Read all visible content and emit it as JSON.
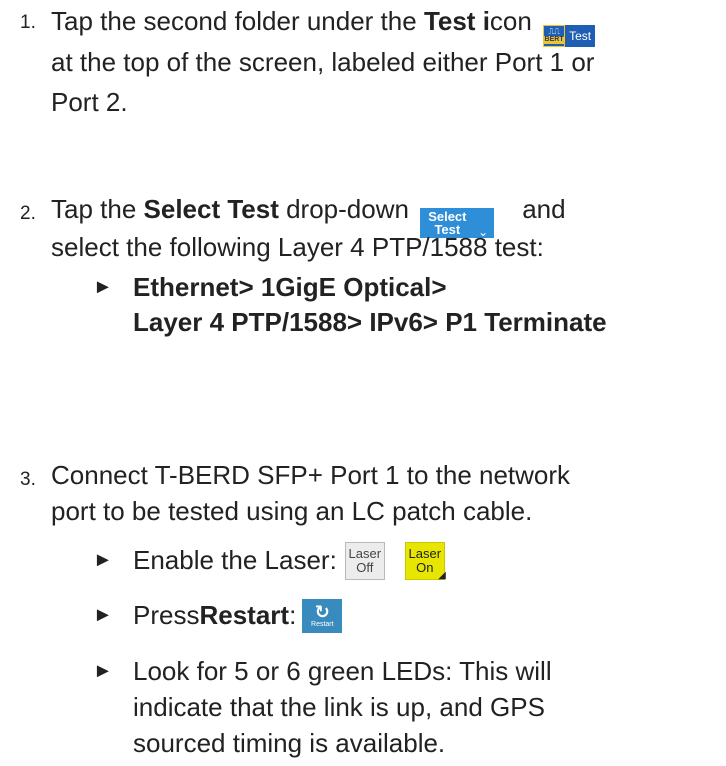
{
  "steps": [
    {
      "number": "1.",
      "line1_pre": "Tap the second folder under the ",
      "line1_bold": "Test i",
      "line1_post": "con",
      "line2": "at the top of the screen, labeled either Port 1 or",
      "line3": "Port 2.",
      "icon": {
        "name": "bert-test-icon",
        "badge": "BERT",
        "label": "Test",
        "color": "#1f5fb3"
      }
    },
    {
      "number": "2.",
      "line1_pre": "Tap the ",
      "line1_bold": "Select Test",
      "line1_post": " drop-down",
      "line1_after": "and",
      "line2": "select the following Layer 4 PTP/1588 test:",
      "button": {
        "line1": "Select",
        "line2": "Test",
        "color": "#2e8fd8"
      },
      "bullet1": "Ethernet> 1GigE Optical>",
      "bullet2": "Layer 4 PTP/1588> IPv6> P1 Terminate"
    },
    {
      "number": "3.",
      "line1": "Connect T-BERD SFP+ Port 1 to the network",
      "line2": "port to be tested using an LC patch cable.",
      "bullets": [
        {
          "text": "Enable the Laser:",
          "laser_off": [
            "Laser",
            "Off"
          ],
          "laser_on": [
            "Laser",
            "On"
          ]
        },
        {
          "pre": "Press ",
          "bold": "Restart",
          "post": ":",
          "restart_label": "Restart"
        },
        {
          "l1": "Look for 5 or 6 green LEDs: This will",
          "l2": "indicate that the link is up, and GPS",
          "l3": "sourced timing is available."
        }
      ]
    }
  ]
}
